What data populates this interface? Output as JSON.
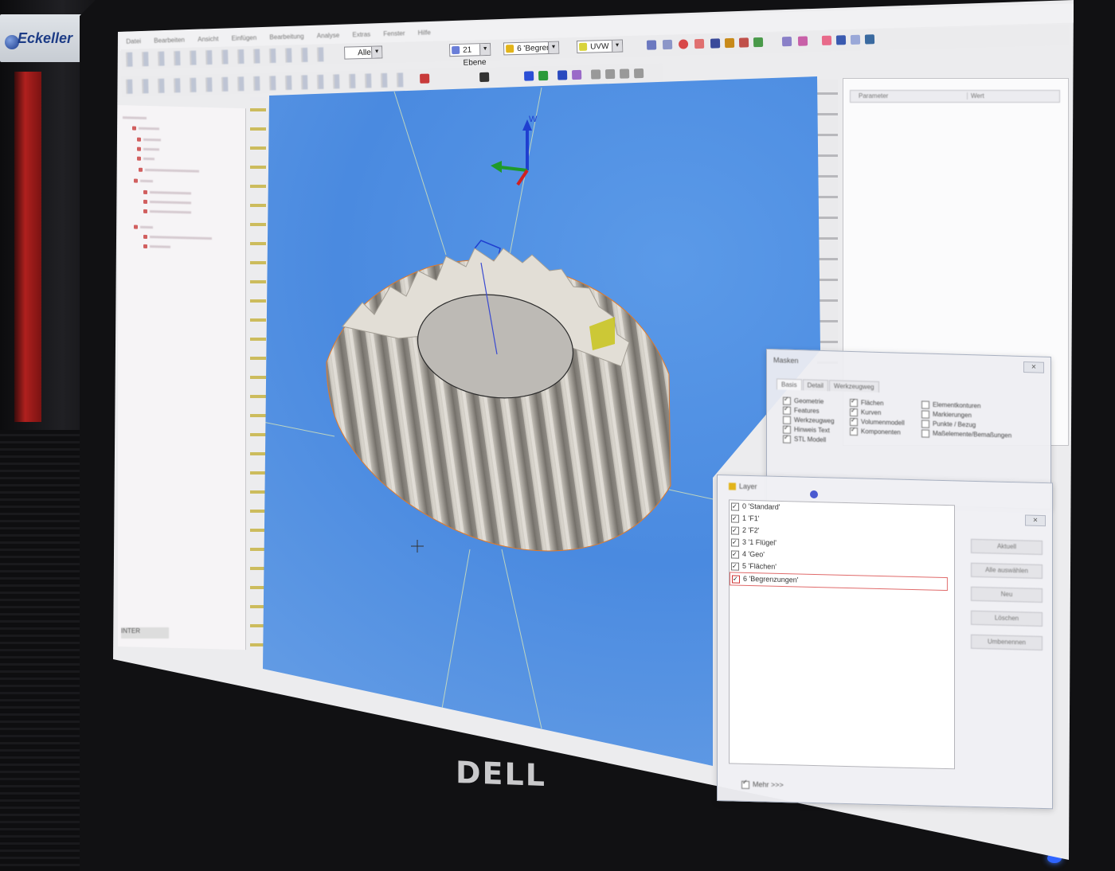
{
  "background": {
    "sticker_text": "Eckeller"
  },
  "monitor": {
    "brand": "DELL"
  },
  "app": {
    "menu_items": [
      "Datei",
      "Bearbeiten",
      "Ansicht",
      "Einfügen",
      "Bearbeitung",
      "Analyse",
      "Extras",
      "Fenster",
      "Hilfe"
    ],
    "toolbar": {
      "zoom_combo": "Alle",
      "plane_combo": "21 Ebene *",
      "layer_combo": "6 'Begrenz",
      "coord_combo": "UVW"
    },
    "axis_triad": {
      "up_label": "W"
    },
    "properties_panel": {
      "col1": "Parameter",
      "col2": "Wert"
    },
    "masks_dialog": {
      "title": "Masken",
      "tabs": [
        "Basis",
        "Detail",
        "Werkzeugweg"
      ],
      "col1": [
        {
          "label": "Geometrie",
          "checked": true
        },
        {
          "label": "Features",
          "checked": true
        },
        {
          "label": "Werkzeugweg",
          "checked": false
        },
        {
          "label": "Hinweis Text",
          "checked": true
        },
        {
          "label": "STL Modell",
          "checked": true
        }
      ],
      "col2": [
        {
          "label": "Flächen",
          "checked": true
        },
        {
          "label": "Kurven",
          "checked": true
        },
        {
          "label": "Volumenmodell",
          "checked": true
        },
        {
          "label": "Komponenten",
          "checked": true
        }
      ],
      "col3": [
        {
          "label": "Elementkonturen",
          "checked": false
        },
        {
          "label": "Markierungen",
          "checked": false
        },
        {
          "label": "Punkte / Bezug",
          "checked": false
        },
        {
          "label": "Maßelemente/Bemaßungen",
          "checked": false
        }
      ]
    },
    "layer_dialog": {
      "title": "Layer",
      "layers": [
        {
          "label": "0 'Standard'",
          "checked": true,
          "selected": false
        },
        {
          "label": "1 'F1'",
          "checked": true,
          "selected": false
        },
        {
          "label": "2 'F2'",
          "checked": true,
          "selected": false
        },
        {
          "label": "3 '1 Flügel'",
          "checked": true,
          "selected": false
        },
        {
          "label": "4 'Geo'",
          "checked": true,
          "selected": false
        },
        {
          "label": "5 'Flächen'",
          "checked": true,
          "selected": false
        },
        {
          "label": "6 'Begrenzungen'",
          "checked": true,
          "selected": true
        }
      ],
      "buttons": [
        "Aktuell",
        "Alle auswählen",
        "Neu",
        "Löschen",
        "Umbenennen"
      ],
      "more_label": "Mehr >>>",
      "more_checked": true
    },
    "status": {
      "left": "INTER"
    }
  },
  "colors": {
    "viewport_blue": "#4a8ae0",
    "gear_gray": "#c8c4bc",
    "axis_blue": "#1f3fd0",
    "axis_green": "#1f9a2a",
    "axis_red": "#d02020",
    "selection_red": "#e06a6a",
    "power_led": "#2f64ff"
  }
}
